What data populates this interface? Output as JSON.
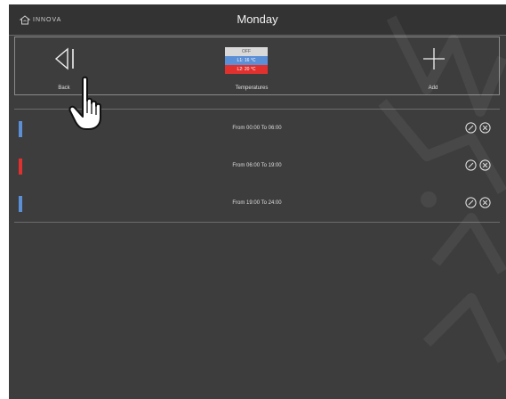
{
  "header": {
    "logo_icon": "innova-logo-icon",
    "logo_text": "INNOVA",
    "title": "Monday"
  },
  "toolbar": {
    "back_label": "Back",
    "temperatures_label": "Temperatures",
    "add_label": "Add",
    "temperature_legend": [
      {
        "label": "OFF",
        "color": "#d9d9d9",
        "text_color": "#555555"
      },
      {
        "label": "L1: 16 °C",
        "color": "#5b8fd6",
        "text_color": "#ffffff"
      },
      {
        "label": "L2: 20 °C",
        "color": "#e0312f",
        "text_color": "#ffffff"
      }
    ]
  },
  "schedule": [
    {
      "text": "From 00:00 To 06:00",
      "color": "#5b8fd6"
    },
    {
      "text": "From 06:00 To 19:00",
      "color": "#e0312f"
    },
    {
      "text": "From 19:00 To 24:00",
      "color": "#5b8fd6"
    }
  ],
  "colors": {
    "background": "#3d3d3d",
    "topbar": "#333333",
    "level1": "#5b8fd6",
    "level2": "#e0312f"
  }
}
